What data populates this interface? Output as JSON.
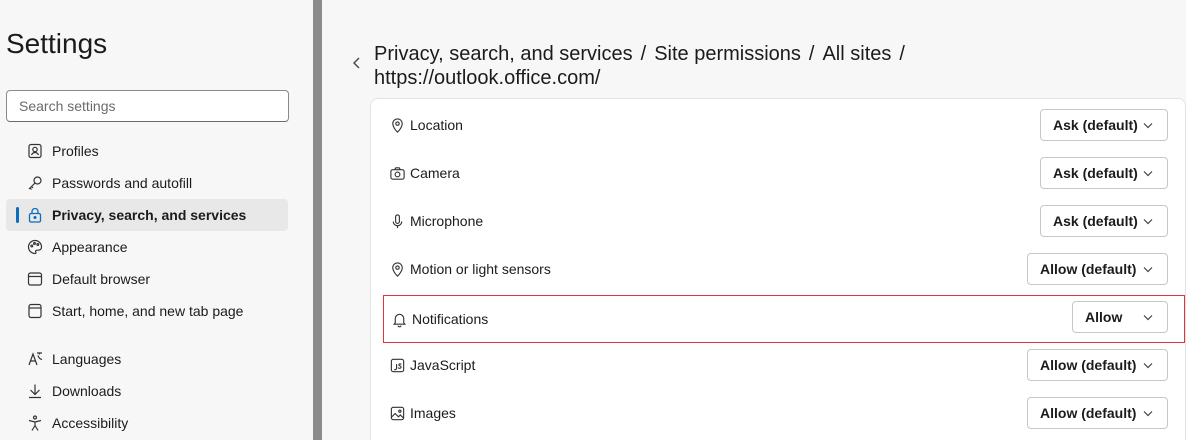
{
  "sidebar": {
    "title": "Settings",
    "search_placeholder": "Search settings",
    "items": [
      {
        "label": "Profiles",
        "icon": "profile-icon"
      },
      {
        "label": "Passwords and autofill",
        "icon": "key-icon"
      },
      {
        "label": "Privacy, search, and services",
        "icon": "lock-icon",
        "active": true
      },
      {
        "label": "Appearance",
        "icon": "palette-icon"
      },
      {
        "label": "Default browser",
        "icon": "browser-icon"
      },
      {
        "label": "Start, home, and new tab page",
        "icon": "home-page-icon"
      },
      {
        "label": "Languages",
        "icon": "language-icon"
      },
      {
        "label": "Downloads",
        "icon": "download-icon"
      },
      {
        "label": "Accessibility",
        "icon": "accessibility-icon"
      }
    ]
  },
  "breadcrumb": {
    "part1": "Privacy, search, and services",
    "part2": "Site permissions",
    "part3": "All sites",
    "separator": "/",
    "part4": "https://outlook.office.com/"
  },
  "permissions": [
    {
      "label": "Location",
      "value": "Ask (default)",
      "icon": "location-icon"
    },
    {
      "label": "Camera",
      "value": "Ask (default)",
      "icon": "camera-icon"
    },
    {
      "label": "Microphone",
      "value": "Ask (default)",
      "icon": "microphone-icon"
    },
    {
      "label": "Motion or light sensors",
      "value": "Allow (default)",
      "icon": "sensor-icon"
    },
    {
      "label": "Notifications",
      "value": "Allow",
      "icon": "bell-icon",
      "highlighted": true
    },
    {
      "label": "JavaScript",
      "value": "Allow (default)",
      "icon": "javascript-icon"
    },
    {
      "label": "Images",
      "value": "Allow (default)",
      "icon": "image-icon"
    }
  ],
  "colors": {
    "accent": "#0f6cbd",
    "highlight_border": "#e0343b"
  }
}
